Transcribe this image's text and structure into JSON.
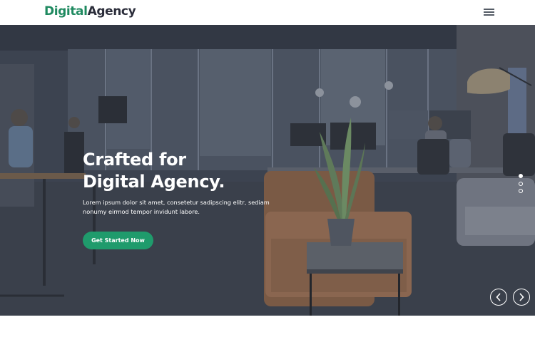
{
  "header": {
    "logo_primary": "Digital",
    "logo_secondary": "Agency",
    "menu_icon": "hamburger-menu-icon"
  },
  "hero": {
    "title_line1": "Crafted for",
    "title_line2": "Digital Agency.",
    "text": "Lorem ipsum dolor sit amet, consetetur sadipscing elitr, sediam nonumy eirmod tempor invidunt labore.",
    "cta_label": "Get Started Now",
    "background_icon": "office-photo",
    "slider": {
      "slide_count": 3,
      "active_index": 0
    },
    "prev_icon": "chevron-left-icon",
    "next_icon": "chevron-right-icon"
  },
  "colors": {
    "brand_green": "#1f8a60",
    "button_green": "#1f9b6c",
    "logo_dark": "#2b2d3a",
    "overlay": "#3c4350"
  }
}
